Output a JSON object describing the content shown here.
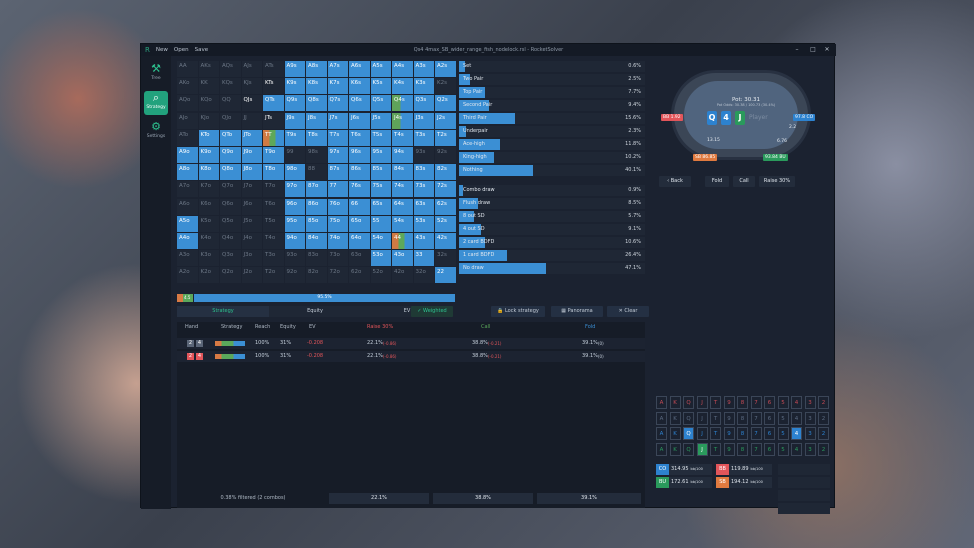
{
  "titlebar": {
    "logo": "R",
    "menu": [
      "New",
      "Open",
      "Save"
    ],
    "title": "Qs4 4max_SB_wider_range_fish_nodelock.rsl - RocketSolver"
  },
  "sidebar": [
    {
      "icon": "hammer-icon",
      "label": "Tree"
    },
    {
      "icon": "search-icon",
      "label": "Strategy"
    },
    {
      "icon": "gear-icon",
      "label": "Settings"
    }
  ],
  "grid": {
    "rows": [
      [
        "AA",
        "AKs",
        "AQs",
        "AJs",
        "ATs",
        "A9s",
        "A8s",
        "A7s",
        "A6s",
        "A5s",
        "A4s",
        "A3s",
        "A2s"
      ],
      [
        "AKo",
        "KK",
        "KQs",
        "KJs",
        "KTs",
        "K9s",
        "K8s",
        "K7s",
        "K6s",
        "K5s",
        "K4s",
        "K3s",
        "K2s"
      ],
      [
        "AQo",
        "KQo",
        "QQ",
        "QJs",
        "QTs",
        "Q9s",
        "Q8s",
        "Q7s",
        "Q6s",
        "Q5s",
        "Q4s",
        "Q3s",
        "Q2s"
      ],
      [
        "AJo",
        "KJo",
        "QJo",
        "JJ",
        "JTs",
        "J9s",
        "J8s",
        "J7s",
        "J6s",
        "J5s",
        "J4s",
        "J3s",
        "J2s"
      ],
      [
        "ATo",
        "KTo",
        "QTo",
        "JTo",
        "TT",
        "T9s",
        "T8s",
        "T7s",
        "T6s",
        "T5s",
        "T4s",
        "T3s",
        "T2s"
      ],
      [
        "A9o",
        "K9o",
        "Q9o",
        "J9o",
        "T9o",
        "99",
        "98s",
        "97s",
        "96s",
        "95s",
        "94s",
        "93s",
        "92s"
      ],
      [
        "A8o",
        "K8o",
        "Q8o",
        "J8o",
        "T8o",
        "98o",
        "88",
        "87s",
        "86s",
        "85s",
        "84s",
        "83s",
        "82s"
      ],
      [
        "A7o",
        "K7o",
        "Q7o",
        "J7o",
        "T7o",
        "97o",
        "87o",
        "77",
        "76s",
        "75s",
        "74s",
        "73s",
        "72s"
      ],
      [
        "A6o",
        "K6o",
        "Q6o",
        "J6o",
        "T6o",
        "96o",
        "86o",
        "76o",
        "66",
        "65s",
        "64s",
        "63s",
        "62s"
      ],
      [
        "A5o",
        "K5o",
        "Q5o",
        "J5o",
        "T5o",
        "95o",
        "85o",
        "75o",
        "65o",
        "55",
        "54s",
        "53s",
        "52s"
      ],
      [
        "A4o",
        "K4o",
        "Q4o",
        "J4o",
        "T4o",
        "94o",
        "84o",
        "74o",
        "64o",
        "54o",
        "44",
        "43s",
        "42s"
      ],
      [
        "A3o",
        "K3o",
        "Q3o",
        "J3o",
        "T3o",
        "93o",
        "83o",
        "73o",
        "63o",
        "53o",
        "43o",
        "33",
        "32s"
      ],
      [
        "A2o",
        "K2o",
        "Q2o",
        "J2o",
        "T2o",
        "92o",
        "82o",
        "72o",
        "62o",
        "52o",
        "42o",
        "32o",
        "22"
      ]
    ],
    "state": [
      "0000011111111",
      "000011111111",
      "0000111111111",
      "0000011111111",
      "0111011111111",
      "1111100111100",
      "1111110111111",
      "0000011111111",
      "0000011111111",
      "1000011111111",
      "1000011111111",
      "0000000001110",
      "0000000000001"
    ]
  },
  "freq_bar": {
    "label": "95.5%",
    "left_label": "4.5",
    "raise_pct": 4.5
  },
  "categories_made": [
    {
      "name": "Set",
      "pct": "0.6%",
      "fill": 3
    },
    {
      "name": "Two Pair",
      "pct": "2.5%",
      "fill": 6
    },
    {
      "name": "Top Pair",
      "pct": "7.7%",
      "fill": 14
    },
    {
      "name": "Second Pair",
      "pct": "9.4%",
      "fill": 16
    },
    {
      "name": "Third Pair",
      "pct": "15.6%",
      "fill": 30
    },
    {
      "name": "Underpair",
      "pct": "2.3%",
      "fill": 4
    },
    {
      "name": "Ace-high",
      "pct": "11.8%",
      "fill": 22
    },
    {
      "name": "King-high",
      "pct": "10.2%",
      "fill": 19
    },
    {
      "name": "Nothing",
      "pct": "40.1%",
      "fill": 40
    }
  ],
  "categories_draw": [
    {
      "name": "Combo draw",
      "pct": "0.9%",
      "fill": 2
    },
    {
      "name": "Flush draw",
      "pct": "8.5%",
      "fill": 10
    },
    {
      "name": "8 out SD",
      "pct": "5.7%",
      "fill": 8
    },
    {
      "name": "4 out SD",
      "pct": "9.1%",
      "fill": 12
    },
    {
      "name": "2 card BDFD",
      "pct": "10.6%",
      "fill": 14
    },
    {
      "name": "1 card BDFD",
      "pct": "26.4%",
      "fill": 26
    },
    {
      "name": "No draw",
      "pct": "47.1%",
      "fill": 47
    }
  ],
  "result_tabs": [
    "Strategy",
    "Equity",
    "EV"
  ],
  "panel_buttons": {
    "weighted": "Weighted",
    "lock": "Lock strategy",
    "panorama": "Panorama",
    "clear": "Clear"
  },
  "table_headers": {
    "hand": "Hand",
    "strategy": "Strategy",
    "reach": "Reach",
    "equity": "Equity",
    "ev": "EV",
    "raise": "Raise 30%",
    "call": "Call",
    "fold": "Fold"
  },
  "hands": [
    {
      "c1": "2",
      "c2": "4",
      "reach": "100%",
      "equity": "31%",
      "ev": "-0.208",
      "raise": "22.1%",
      "raise_ev": "(-0.86)",
      "call": "38.8%",
      "call_ev": "(-0.21)",
      "fold": "39.1%",
      "fold_ev": "(0)"
    },
    {
      "c1": "2",
      "c2": "4",
      "reach": "100%",
      "equity": "31%",
      "ev": "-0.208",
      "raise": "22.1%",
      "raise_ev": "(-0.86)",
      "call": "38.8%",
      "call_ev": "(-0.21)",
      "fold": "39.1%",
      "fold_ev": "(0)"
    }
  ],
  "footer": {
    "filtered": "0.38% filtered (2 combos)",
    "raise": "22.1%",
    "call": "38.8%",
    "fold": "39.1%"
  },
  "colors": {
    "raise": "#e2555a",
    "call": "#5ba85b",
    "fold": "#3b8fd4",
    "accent": "#22a27d"
  },
  "poker_table": {
    "pot": "Pot: 30.31",
    "pot_odds": "Pot Odds: 30.38 / 100.73 (30.4%)",
    "board": [
      "Q",
      "4",
      "J"
    ],
    "player": "Player",
    "seats": [
      {
        "pos": "BB",
        "stack": "1.92"
      },
      {
        "pos": "CO",
        "stack": "97.8"
      },
      {
        "pos": "SB",
        "stack": "86.85"
      },
      {
        "pos": "BU",
        "stack": "93.84"
      }
    ],
    "bets": [
      "13.15",
      "2.2",
      "6.76"
    ]
  },
  "actions": {
    "back": "Back",
    "fold": "Fold",
    "call": "Call",
    "raise": "Raise 30%"
  },
  "board_rows": [
    [
      "A",
      "K",
      "Q",
      "J",
      "T",
      "9",
      "8",
      "7",
      "6",
      "5",
      "4",
      "3",
      "2"
    ]
  ],
  "summary": [
    {
      "pos": "CO",
      "val": "314.95",
      "unit": "bb/100"
    },
    {
      "pos": "BB",
      "val": "119.89",
      "unit": "bb/100"
    },
    {
      "pos": "BU",
      "val": "172.61",
      "unit": "bb/100"
    },
    {
      "pos": "SB",
      "val": "194.12",
      "unit": "bb/100"
    }
  ]
}
